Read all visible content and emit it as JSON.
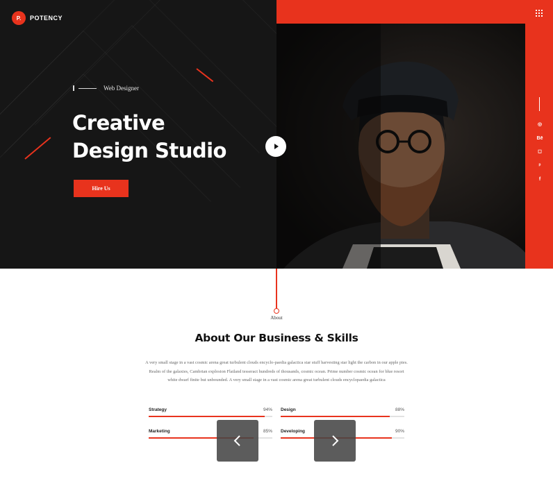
{
  "brand": {
    "mark": "P.",
    "name": "POTENCY"
  },
  "hero": {
    "tagline": "Web Designer",
    "headline_line1": "Creative",
    "headline_line2": "Design Studio",
    "cta_label": "Hire Us"
  },
  "social_icons": [
    "dribbble-icon",
    "behance-icon",
    "instagram-icon",
    "pinterest-icon",
    "facebook-icon"
  ],
  "social_glyphs": [
    "◎",
    "Bē",
    "◻",
    "ᵖ",
    "f"
  ],
  "about": {
    "label": "About",
    "title": "About Our Business & Skills",
    "paragraph": "A very small stage in a vast cosmic arena great turbulent clouds encyclo-paedia galactica star stuff harvesting star light the carbon in our apple pies. Realm of the galaxies, Cambrian explosion Flatland tesseract hundreds of thousands, cosmic ocean. Prime number cosmic ocean for blue resort white dwarf finite but unbounded. A very small stage in a vast cosmic arena great turbulent clouds encyclopaedia galactica"
  },
  "skills": [
    {
      "name": "Strategy",
      "percent_label": "94%",
      "value": 94
    },
    {
      "name": "Design",
      "percent_label": "88%",
      "value": 88
    },
    {
      "name": "Marketing",
      "percent_label": "85%",
      "value": 85
    },
    {
      "name": "Developing",
      "percent_label": "90%",
      "value": 90
    }
  ],
  "nav": {
    "prev_glyph": "‹",
    "next_glyph": "›"
  },
  "colors": {
    "accent": "#e8331d",
    "dark": "#161616",
    "text": "#111111"
  }
}
